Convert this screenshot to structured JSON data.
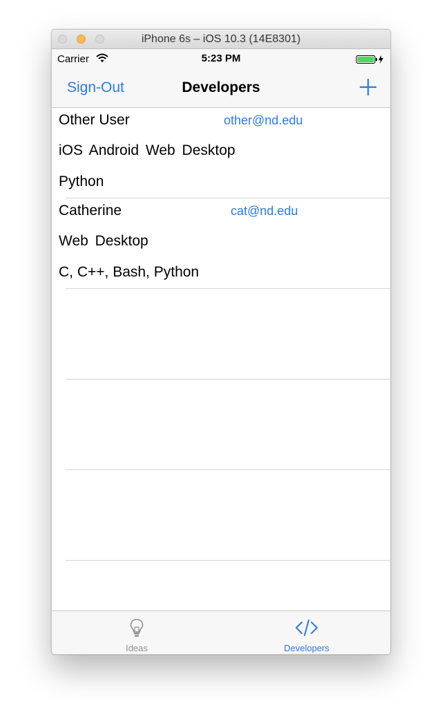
{
  "window": {
    "title": "iPhone 6s – iOS 10.3 (14E8301)"
  },
  "status_bar": {
    "carrier": "Carrier",
    "time": "5:23 PM",
    "wifi_icon": "wifi-icon",
    "battery_icon": "battery-icon"
  },
  "nav": {
    "left_button": "Sign-Out",
    "title": "Developers",
    "add_icon": "plus-icon"
  },
  "developers": [
    {
      "name": "Other User",
      "email": "other@nd.edu",
      "platforms": "iOS  Android  Web  Desktop",
      "languages": "Python"
    },
    {
      "name": "Catherine",
      "email": "cat@nd.edu",
      "platforms": "Web  Desktop",
      "languages": "C, C++, Bash, Python"
    }
  ],
  "tab_bar": {
    "tabs": [
      {
        "label": "Ideas",
        "icon": "lightbulb-icon",
        "selected": false
      },
      {
        "label": "Developers",
        "icon": "code-icon",
        "selected": true
      }
    ]
  },
  "colors": {
    "accent": "#2a7ae2",
    "inactive": "#8e8e8e",
    "bar_bg": "#f7f7f7"
  }
}
